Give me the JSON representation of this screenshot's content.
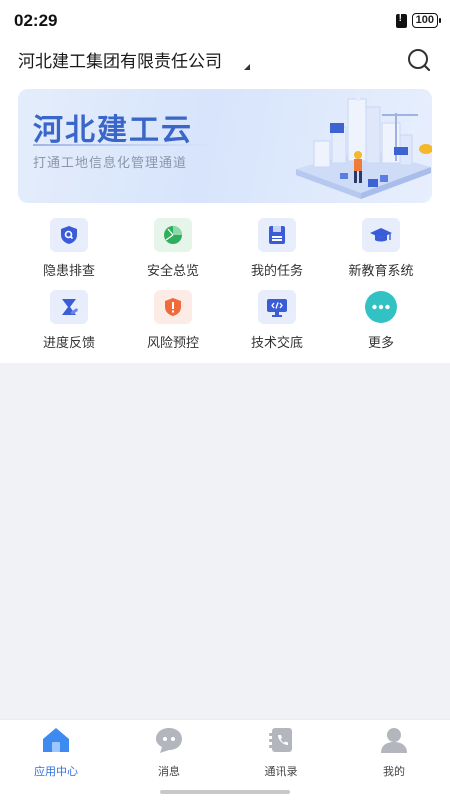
{
  "status": {
    "time": "02:29",
    "battery": "100"
  },
  "header": {
    "company": "河北建工集团有限责任公司"
  },
  "banner": {
    "title": "河北建工云",
    "subtitle": "打通工地信息化管理通道"
  },
  "grid": [
    {
      "label": "隐患排查",
      "icon": "hazard-search-icon",
      "color": "#3a5cd6"
    },
    {
      "label": "安全总览",
      "icon": "pie-chart-icon",
      "color": "#2fae5c"
    },
    {
      "label": "我的任务",
      "icon": "task-save-icon",
      "color": "#3a5cd6"
    },
    {
      "label": "新教育系统",
      "icon": "graduation-cap-icon",
      "color": "#3a5cd6"
    },
    {
      "label": "进度反馈",
      "icon": "progress-feedback-icon",
      "color": "#3a5cd6"
    },
    {
      "label": "风险预控",
      "icon": "risk-shield-icon",
      "color": "#f06a3b"
    },
    {
      "label": "技术交底",
      "icon": "code-monitor-icon",
      "color": "#3a5cd6"
    },
    {
      "label": "更多",
      "icon": "more-dots-icon",
      "color": "#33c2c4"
    }
  ],
  "tabs": [
    {
      "label": "应用中心",
      "icon": "home-icon",
      "active": true
    },
    {
      "label": "消息",
      "icon": "message-icon",
      "active": false
    },
    {
      "label": "通讯录",
      "icon": "contacts-icon",
      "active": false
    },
    {
      "label": "我的",
      "icon": "profile-icon",
      "active": false
    }
  ],
  "colors": {
    "accent": "#3172e0",
    "banner_title": "#3a66c9",
    "background": "#f1f2f5"
  }
}
